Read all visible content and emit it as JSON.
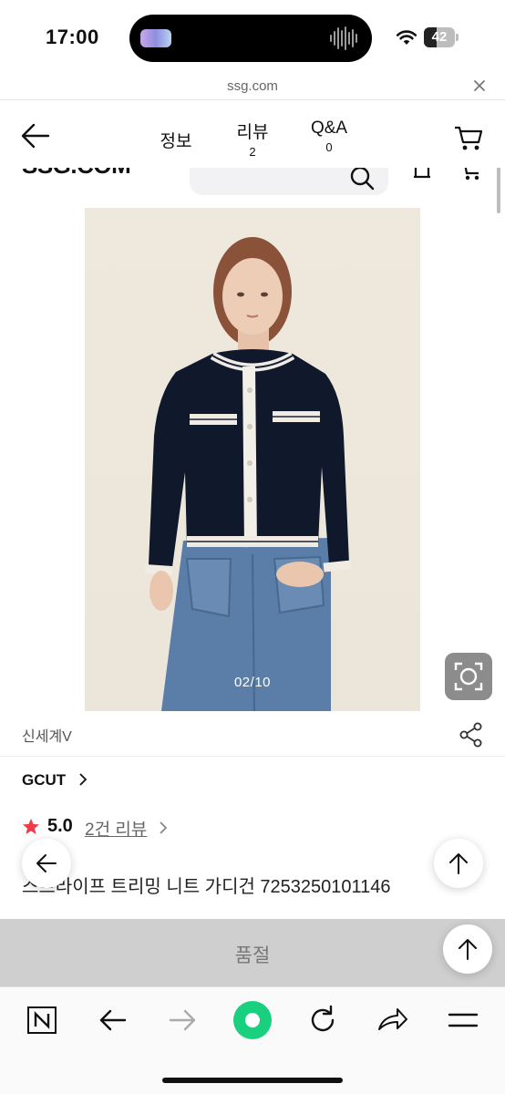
{
  "status_bar": {
    "time": "17:00",
    "battery": "42",
    "battery_level": 0.42
  },
  "url_bar": {
    "domain": "ssg.com"
  },
  "header": {
    "tabs": [
      {
        "label": "정보",
        "count": ""
      },
      {
        "label": "리뷰",
        "count": "2"
      },
      {
        "label": "Q&A",
        "count": "0"
      }
    ]
  },
  "underlying_header": {
    "logo": "SSG.COM"
  },
  "product": {
    "image_counter": "02/10",
    "seller": "신세계V",
    "brand": "GCUT",
    "rating": "5.0",
    "review_link": "2건 리뷰",
    "title": "스트라이프 트리밍 니트 가디건 7253250101146",
    "status": "품절"
  },
  "colors": {
    "star": "#ef3b4a",
    "counter_text": "#ffffff",
    "soldout_bg": "#cfcfcf",
    "accent_green": "#19d07e"
  },
  "icons": [
    "back-arrow-icon",
    "cart-icon",
    "close-icon",
    "wifi-icon",
    "share-icon",
    "star-icon",
    "chevron-right-icon",
    "lens-icon",
    "up-arrow-icon",
    "naver-n-icon",
    "forward-arrow-icon",
    "reload-icon",
    "share-arrow-icon",
    "menu-icon"
  ]
}
